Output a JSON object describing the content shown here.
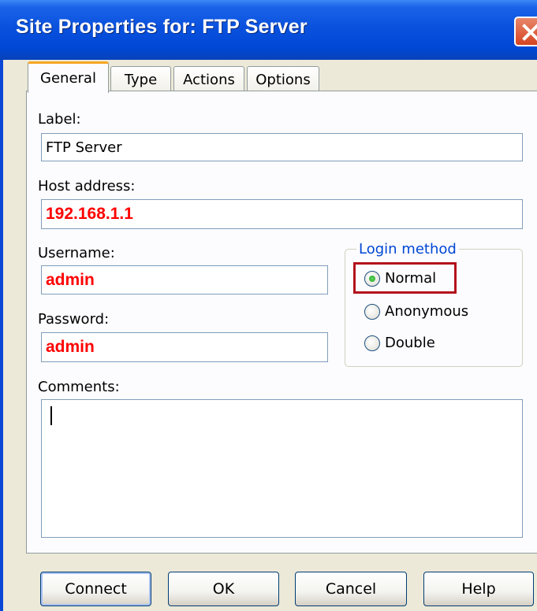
{
  "window": {
    "title": "Site Properties for: FTP Server"
  },
  "tabs": [
    {
      "label": "General",
      "active": true
    },
    {
      "label": "Type",
      "active": false
    },
    {
      "label": "Actions",
      "active": false
    },
    {
      "label": "Options",
      "active": false
    }
  ],
  "form": {
    "label_caption": "Label:",
    "label_value": "FTP Server",
    "host_caption": "Host address:",
    "host_value": "192.168.1.1",
    "username_caption": "Username:",
    "username_value": "admin",
    "password_caption": "Password:",
    "password_value": "admin",
    "comments_caption": "Comments:",
    "comments_value": ""
  },
  "login_method": {
    "legend": "Login method",
    "options": [
      {
        "label": "Normal",
        "selected": true
      },
      {
        "label": "Anonymous",
        "selected": false
      },
      {
        "label": "Double",
        "selected": false
      }
    ]
  },
  "buttons": {
    "connect": "Connect",
    "ok": "OK",
    "cancel": "Cancel",
    "help": "Help"
  },
  "colors": {
    "titlebar": "#0a52de",
    "highlight": "#b3121c",
    "red_text": "#ff0000",
    "legend_text": "#0046d5"
  }
}
